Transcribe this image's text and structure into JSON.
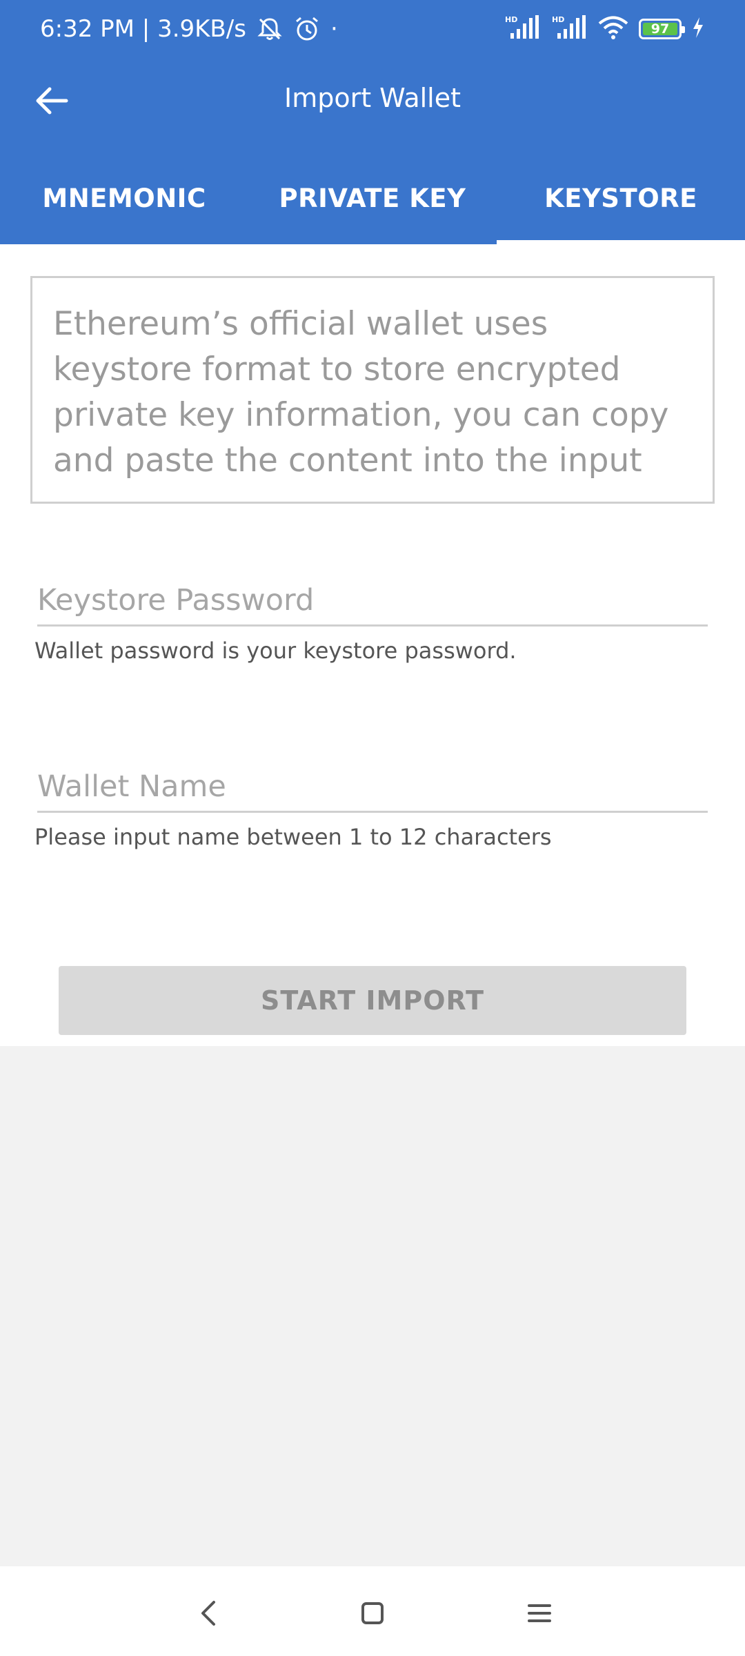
{
  "status_bar": {
    "time_speed": "6:32 PM | 3.9KB/s",
    "dot": "·",
    "battery_level": "97",
    "icons": [
      "bell-off-icon",
      "alarm-icon",
      "signal-hd-icon",
      "signal-hd-icon",
      "wifi-icon",
      "battery-icon",
      "charging-icon"
    ]
  },
  "toolbar": {
    "title": "Import Wallet",
    "back_icon": "arrow-left-icon"
  },
  "tabs": [
    {
      "label": "MNEMONIC",
      "active": false
    },
    {
      "label": "PRIVATE KEY",
      "active": false
    },
    {
      "label": "KEYSTORE",
      "active": true
    }
  ],
  "form": {
    "keystore_placeholder": "Ethereum’s official wallet uses keystore format to store encrypted private key information, you can copy and paste the content into the input",
    "password_placeholder": "Keystore Password",
    "password_hint": "Wallet password is your keystore password.",
    "name_placeholder": "Wallet Name",
    "name_hint": "Please input name between 1 to 12 characters",
    "start_button": "START IMPORT"
  },
  "nav_bar": {
    "icons": [
      "back-icon",
      "home-icon",
      "menu-icon"
    ]
  },
  "colors": {
    "header_bg": "#3a75cc",
    "page_bg": "#f2f2f2",
    "button_disabled": "#d9d9d9",
    "battery_fill": "#5cc24a"
  }
}
